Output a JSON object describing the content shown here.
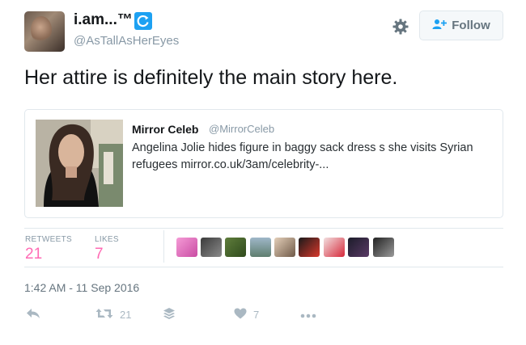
{
  "author": {
    "display_name": "i.am...™",
    "handle": "@AsTallAsHerEyes"
  },
  "header": {
    "follow_label": "Follow"
  },
  "tweet": {
    "text": "Her attire is definitely the main story here."
  },
  "quoted": {
    "name": "Mirror Celeb",
    "handle": "@MirrorCeleb",
    "text": "Angelina Jolie hides figure in baggy sack dress s she visits Syrian refugees mirror.co.uk/3am/celebrity-..."
  },
  "stats": {
    "retweets_label": "RETWEETS",
    "retweets_count": "21",
    "likes_label": "LIKES",
    "likes_count": "7"
  },
  "timestamp": "1:42 AM - 11 Sep 2016",
  "actions": {
    "retweet_count": "21",
    "like_count": "7"
  },
  "colors": {
    "accent": "#1da1f2",
    "like_pink": "#ff6ab4",
    "muted": "#aab8c2"
  },
  "icons": [
    "reply-icon",
    "retweet-icon",
    "buffer-stack-icon",
    "heart-icon",
    "more-icon",
    "gear-icon",
    "follow-person-icon",
    "verified-refresh-icon"
  ]
}
